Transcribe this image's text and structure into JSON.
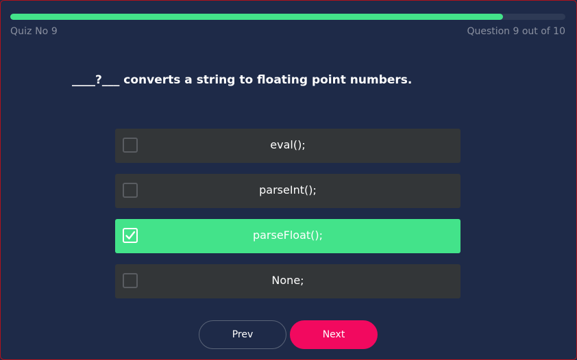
{
  "progress": {
    "fraction": 0.888
  },
  "header": {
    "quiz_label": "Quiz No 9",
    "question_counter": "Question 9 out of 10"
  },
  "question": {
    "text": "____?___ converts a string to floating point numbers."
  },
  "options": [
    {
      "label": "eval();",
      "selected": false
    },
    {
      "label": "parseInt();",
      "selected": false
    },
    {
      "label": "parseFloat();",
      "selected": true
    },
    {
      "label": "None;",
      "selected": false
    }
  ],
  "nav": {
    "prev_label": "Prev",
    "next_label": "Next"
  },
  "colors": {
    "background": "#1e2a48",
    "accent_green": "#43e38a",
    "option_bg": "#333638",
    "next_pink": "#f2095f",
    "muted_text": "#8a90a0"
  },
  "icons": {
    "checkbox_checked": "check-icon"
  }
}
